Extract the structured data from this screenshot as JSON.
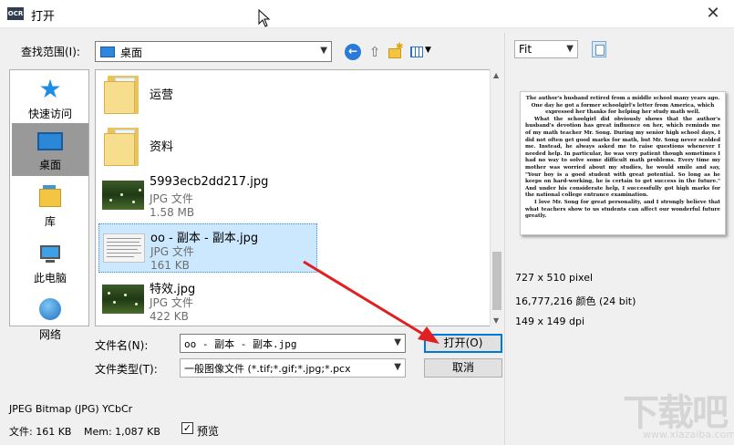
{
  "window": {
    "app_logo": "OCR",
    "title": "打开",
    "close_label": "✕"
  },
  "lookin": {
    "label": "查找范围(I):",
    "value": "桌面"
  },
  "toolbar": {
    "back_icon": "back-arrow-icon",
    "up_icon": "up-folder-icon",
    "new_folder_icon": "new-folder-icon",
    "view_menu_icon": "view-menu-icon"
  },
  "places": [
    {
      "label": "快速访问",
      "icon": "star-icon"
    },
    {
      "label": "桌面",
      "icon": "desktop-icon",
      "selected": true
    },
    {
      "label": "库",
      "icon": "library-icon"
    },
    {
      "label": "此电脑",
      "icon": "computer-icon"
    },
    {
      "label": "网络",
      "icon": "network-icon"
    }
  ],
  "files": [
    {
      "name": "运营",
      "kind": "folder"
    },
    {
      "name": "资料",
      "kind": "folder"
    },
    {
      "name": "5993ecb2dd217.jpg",
      "type": "JPG 文件",
      "size": "1.58 MB",
      "kind": "image"
    },
    {
      "name": "oo - 副本 - 副本.jpg",
      "type": "JPG 文件",
      "size": "161 KB",
      "kind": "doc",
      "selected": true
    },
    {
      "name": "特效.jpg",
      "type": "JPG 文件",
      "size": "422 KB",
      "kind": "image"
    }
  ],
  "filename": {
    "label": "文件名(N):",
    "value": "oo - 副本 - 副本.jpg"
  },
  "filetype": {
    "label": "文件类型(T):",
    "value": "一般图像文件 (*.tif;*.gif;*.jpg;*.pcx"
  },
  "buttons": {
    "open": "打开(O)",
    "cancel": "取消"
  },
  "preview": {
    "zoom": "Fit",
    "text": [
      "The author's husband retired from a middle school many years ago. One day he got a former schoolgirl's letter from America, which expressed her thanks for helping her study math well.",
      "What the schoolgirl did obviously shows that the author's husband's devotion has great influence on her, which reminds me of my math teacher Mr. Song. During my senior high school days, I did not often get good marks for math, but Mr. Song never scolded me. Instead, he always asked me to raise questions whenever I needed help. In particular, he was very patient though sometimes I had no way to solve some difficult math problems. Every time my mother was worried about my studies, he would smile and say, \"Your boy is a good student with great potential. So long as he keeps on hard-working, he is certain to get success in the future.\" And under his considerate help, I successfully got high marks for the national college entrance examination.",
      "I love Mr. Song for great personality, and I strongly believe that what teachers show to us students can affect our wonderful future greatly."
    ],
    "dimensions": "727 x 510 pixel",
    "colors": "16,777,216 颜色 (24 bit)",
    "dpi": "149 x 149 dpi"
  },
  "status": {
    "format": "JPEG Bitmap (JPG) YCbCr",
    "file_size": "文件: 161 KB",
    "mem": "Mem: 1,087 KB",
    "preview_label": "预览",
    "preview_checked": "✓"
  },
  "watermark": {
    "big": "下载吧",
    "small": "www.xiazaiba.com"
  },
  "colors": {
    "accent": "#0078d7",
    "selection": "#cce8ff",
    "annotation_arrow": "#e02020"
  }
}
